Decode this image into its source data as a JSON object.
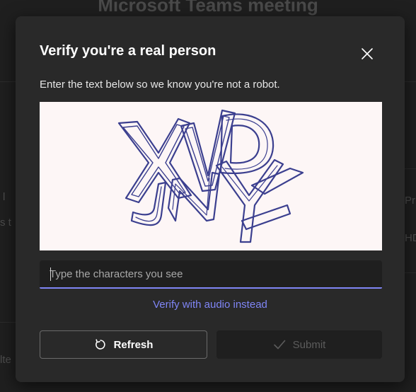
{
  "background": {
    "title": "Microsoft Teams meeting",
    "fragments": [
      "l",
      "s t",
      "Pr",
      "HD",
      "lte"
    ]
  },
  "dialog": {
    "title": "Verify you're a real person",
    "description": "Enter the text below so we know you're not a robot.",
    "captcha_text": "XVD JNY",
    "input": {
      "value": "",
      "placeholder": "Type the characters you see"
    },
    "audio_link": "Verify with audio instead",
    "refresh_label": "Refresh",
    "submit_label": "Submit",
    "icons": {
      "close": "close-icon",
      "refresh": "refresh-icon",
      "submit": "checkmark-icon"
    },
    "colors": {
      "accent": "#7f85f5",
      "dialog_bg": "#292929",
      "captcha_stroke": "#3b3f8f"
    }
  }
}
